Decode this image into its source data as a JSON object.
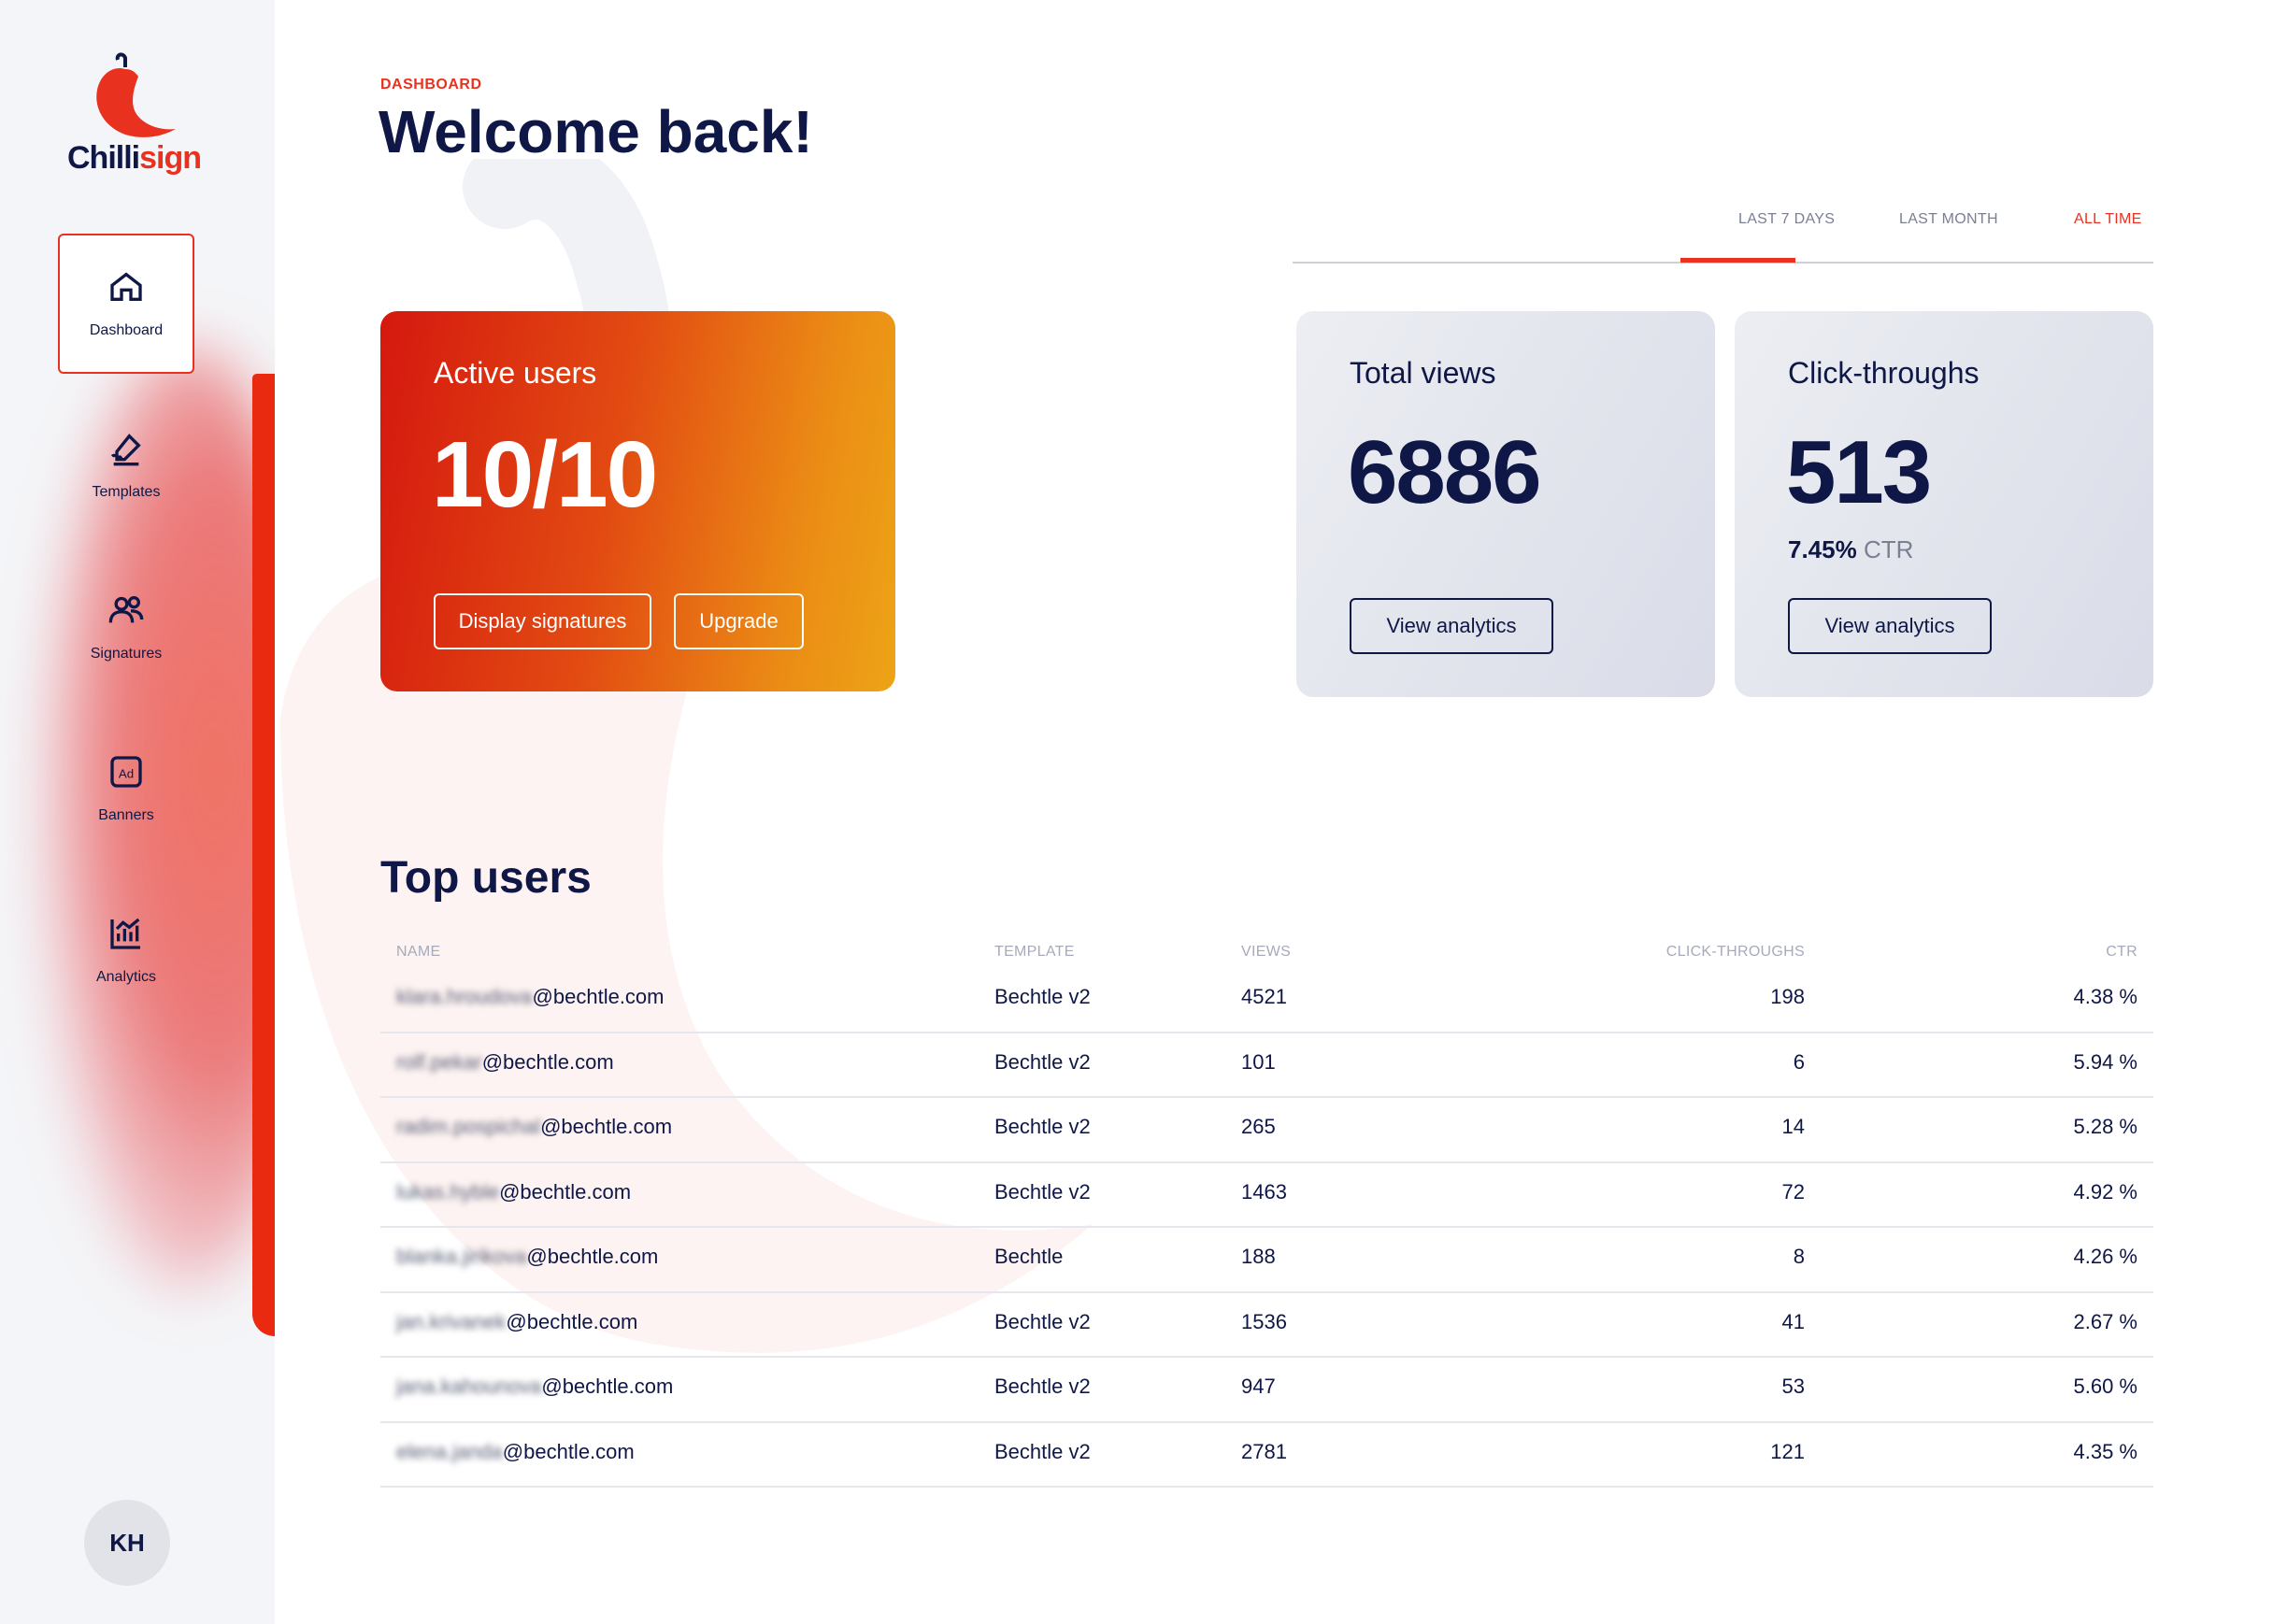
{
  "brand": {
    "logo_text_a": "Chilli",
    "logo_text_b": "sign",
    "accent": "#e8321f",
    "navy": "#0f1746"
  },
  "sidebar": {
    "items": [
      {
        "label": "Dashboard",
        "icon": "home-icon",
        "active": true
      },
      {
        "label": "Templates",
        "icon": "signature-pen-icon",
        "active": false
      },
      {
        "label": "Signatures",
        "icon": "users-icon",
        "active": false
      },
      {
        "label": "Banners",
        "icon": "ad-icon",
        "active": false
      },
      {
        "label": "Analytics",
        "icon": "chart-icon",
        "active": false
      }
    ],
    "avatar_initials": "KH"
  },
  "header": {
    "eyebrow": "DASHBOARD",
    "title": "Welcome back!"
  },
  "range_tabs": [
    {
      "label": "LAST 7 DAYS",
      "active": false
    },
    {
      "label": "LAST MONTH",
      "active": false
    },
    {
      "label": "ALL TIME",
      "active": true
    }
  ],
  "cards": {
    "active_users": {
      "title": "Active users",
      "value": "10/10",
      "btn_display": "Display signatures",
      "btn_upgrade": "Upgrade"
    },
    "total_views": {
      "title": "Total views",
      "value": "6886",
      "btn": "View analytics"
    },
    "click_throughs": {
      "title": "Click-throughs",
      "value": "513",
      "ctr_value": "7.45%",
      "ctr_label": "CTR",
      "btn": "View analytics"
    }
  },
  "top_users": {
    "title": "Top users",
    "columns": {
      "name": "NAME",
      "template": "TEMPLATE",
      "views": "VIEWS",
      "clicks": "CLICK-THROUGHS",
      "ctr": "CTR"
    },
    "rows": [
      {
        "name_local": "klara.hroudova",
        "domain": "@bechtle.com",
        "template": "Bechtle v2",
        "views": "4521",
        "clicks": "198",
        "ctr": "4.38 %"
      },
      {
        "name_local": "rolf.pekar",
        "domain": "@bechtle.com",
        "template": "Bechtle v2",
        "views": "101",
        "clicks": "6",
        "ctr": "5.94 %"
      },
      {
        "name_local": "radim.pospichal",
        "domain": "@bechtle.com",
        "template": "Bechtle v2",
        "views": "265",
        "clicks": "14",
        "ctr": "5.28 %"
      },
      {
        "name_local": "lukas.hyble",
        "domain": "@bechtle.com",
        "template": "Bechtle v2",
        "views": "1463",
        "clicks": "72",
        "ctr": "4.92 %"
      },
      {
        "name_local": "blanka.jirikova",
        "domain": "@bechtle.com",
        "template": "Bechtle",
        "views": "188",
        "clicks": "8",
        "ctr": "4.26 %"
      },
      {
        "name_local": "jan.krivanek",
        "domain": "@bechtle.com",
        "template": "Bechtle v2",
        "views": "1536",
        "clicks": "41",
        "ctr": "2.67 %"
      },
      {
        "name_local": "jana.kahounova",
        "domain": "@bechtle.com",
        "template": "Bechtle v2",
        "views": "947",
        "clicks": "53",
        "ctr": "5.60 %"
      },
      {
        "name_local": "elena.janda",
        "domain": "@bechtle.com",
        "template": "Bechtle v2",
        "views": "2781",
        "clicks": "121",
        "ctr": "4.35 %"
      }
    ]
  }
}
